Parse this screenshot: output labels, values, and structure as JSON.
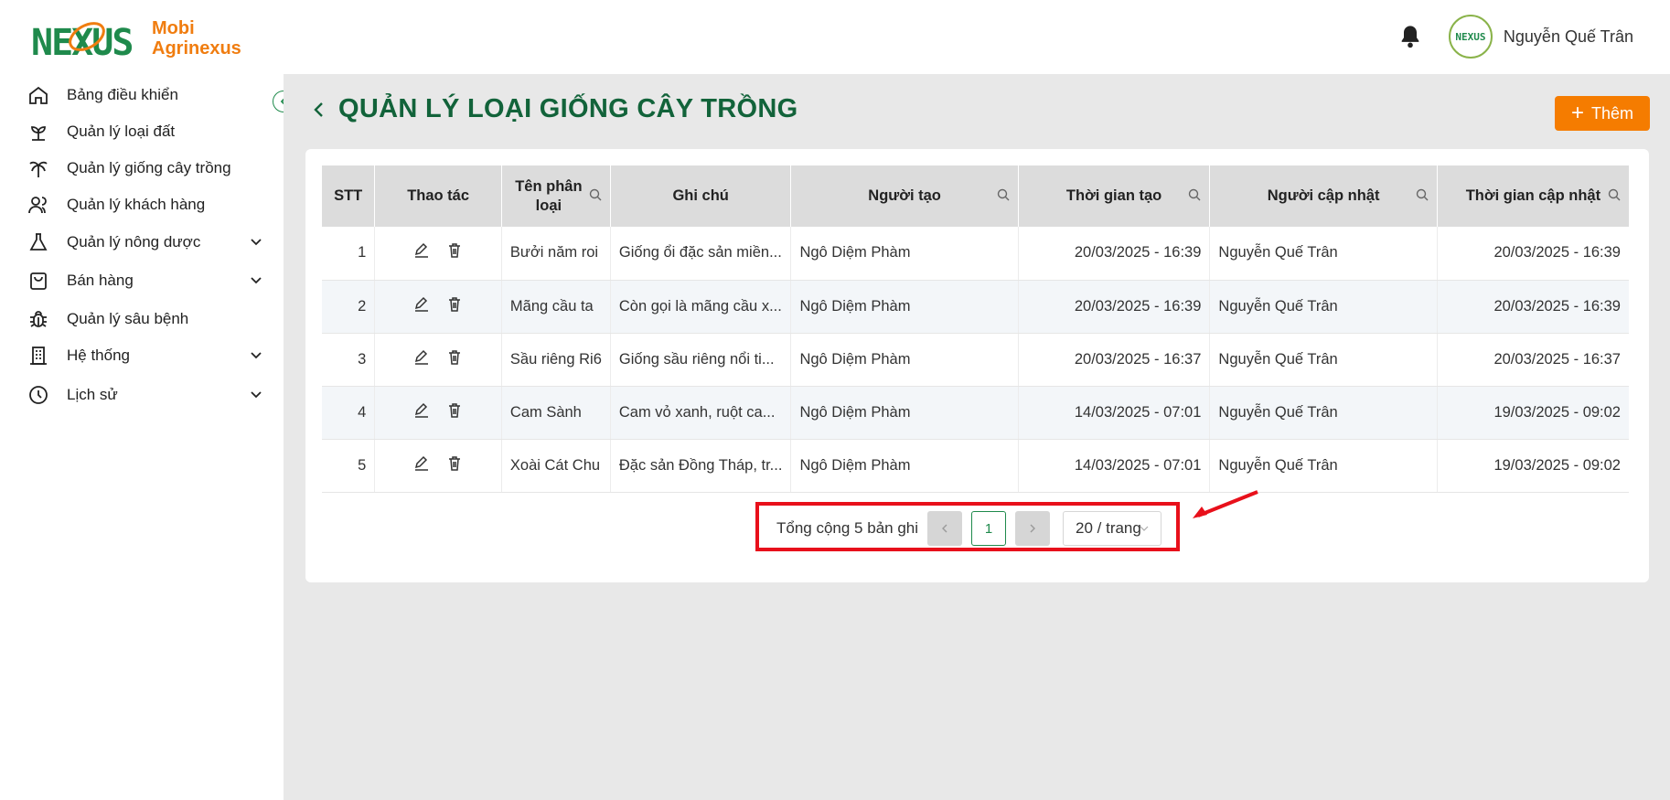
{
  "brand": {
    "line1": "Mobi",
    "line2": "Agrinexus",
    "mark": "NEXUS"
  },
  "header": {
    "username": "Nguyễn Quế Trân",
    "avatar_text": "NEXUS"
  },
  "sidebar": {
    "items": [
      {
        "label": "Bảng điều khiển",
        "icon": "home-icon",
        "expandable": false
      },
      {
        "label": "Quản lý loại đất",
        "icon": "sprout-icon",
        "expandable": false
      },
      {
        "label": "Quản lý giống cây trồng",
        "icon": "palm-tree-icon",
        "expandable": false
      },
      {
        "label": "Quản lý khách hàng",
        "icon": "users-icon",
        "expandable": false
      },
      {
        "label": "Quản lý nông dược",
        "icon": "flask-icon",
        "expandable": true
      },
      {
        "label": "Bán hàng",
        "icon": "shopping-bag-icon",
        "expandable": true
      },
      {
        "label": "Quản lý sâu bệnh",
        "icon": "bug-icon",
        "expandable": false
      },
      {
        "label": "Hệ thống",
        "icon": "building-icon",
        "expandable": true
      },
      {
        "label": "Lịch sử",
        "icon": "clock-icon",
        "expandable": true
      }
    ]
  },
  "page": {
    "title": "QUẢN LÝ LOẠI GIỐNG CÂY TRỒNG",
    "add_label": "Thêm"
  },
  "table": {
    "columns": [
      "STT",
      "Thao tác",
      "Tên phân loại",
      "Ghi chú",
      "Người tạo",
      "Thời gian tạo",
      "Người cập nhật",
      "Thời gian cập nhật"
    ],
    "rows": [
      {
        "stt": "1",
        "name": "Bưởi năm roi",
        "note": "Giống ổi đặc sản miền...",
        "creator": "Ngô Diệm Phàm",
        "created": "20/03/2025 - 16:39",
        "updater": "Nguyễn Quế Trân",
        "updated": "20/03/2025 - 16:39"
      },
      {
        "stt": "2",
        "name": "Mãng cầu ta",
        "note": "Còn gọi là mãng cầu x...",
        "creator": "Ngô Diệm Phàm",
        "created": "20/03/2025 - 16:39",
        "updater": "Nguyễn Quế Trân",
        "updated": "20/03/2025 - 16:39"
      },
      {
        "stt": "3",
        "name": "Sầu riêng Ri6",
        "note": "Giống sầu riêng nổi ti...",
        "creator": "Ngô Diệm Phàm",
        "created": "20/03/2025 - 16:37",
        "updater": "Nguyễn Quế Trân",
        "updated": "20/03/2025 - 16:37"
      },
      {
        "stt": "4",
        "name": "Cam Sành",
        "note": "Cam vỏ xanh, ruột ca...",
        "creator": "Ngô Diệm Phàm",
        "created": "14/03/2025 - 07:01",
        "updater": "Nguyễn Quế Trân",
        "updated": "19/03/2025 - 09:02"
      },
      {
        "stt": "5",
        "name": "Xoài Cát Chu",
        "note": "Đặc sản Đồng Tháp, tr...",
        "creator": "Ngô Diệm Phàm",
        "created": "14/03/2025 - 07:01",
        "updater": "Nguyễn Quế Trân",
        "updated": "19/03/2025 - 09:02"
      }
    ]
  },
  "pagination": {
    "total_label": "Tổng cộng 5 bản ghi",
    "current_page": "1",
    "page_size": "20 / trang"
  },
  "colors": {
    "brand_green": "#1f8a4c",
    "title_green": "#12633a",
    "accent_orange": "#f57c00",
    "highlight_red": "#e8101b"
  }
}
